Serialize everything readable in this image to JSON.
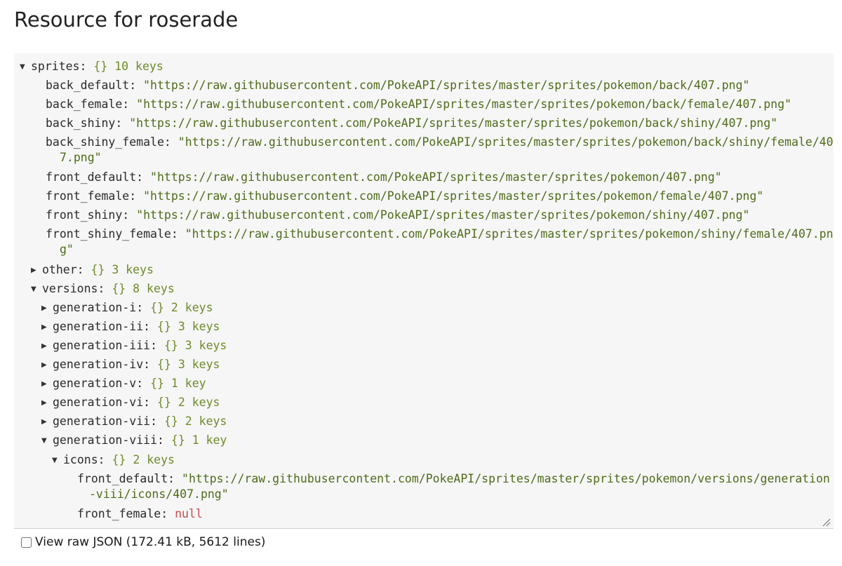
{
  "page": {
    "title": "Resource for roserade"
  },
  "tree": {
    "sprites": {
      "key": "sprites",
      "brace": "{}",
      "count": "10 keys",
      "entries": {
        "back_default": {
          "key": "back_default",
          "value": "\"https://raw.githubusercontent.com/PokeAPI/sprites/master/sprites/pokemon/back/407.png\""
        },
        "back_female": {
          "key": "back_female",
          "value": "\"https://raw.githubusercontent.com/PokeAPI/sprites/master/sprites/pokemon/back/female/407.png\""
        },
        "back_shiny": {
          "key": "back_shiny",
          "value": "\"https://raw.githubusercontent.com/PokeAPI/sprites/master/sprites/pokemon/back/shiny/407.png\""
        },
        "back_shiny_female": {
          "key": "back_shiny_female",
          "value": "\"https://raw.githubusercontent.com/PokeAPI/sprites/master/sprites/pokemon/back/shiny/female/407.png\""
        },
        "front_default": {
          "key": "front_default",
          "value": "\"https://raw.githubusercontent.com/PokeAPI/sprites/master/sprites/pokemon/407.png\""
        },
        "front_female": {
          "key": "front_female",
          "value": "\"https://raw.githubusercontent.com/PokeAPI/sprites/master/sprites/pokemon/female/407.png\""
        },
        "front_shiny": {
          "key": "front_shiny",
          "value": "\"https://raw.githubusercontent.com/PokeAPI/sprites/master/sprites/pokemon/shiny/407.png\""
        },
        "front_shiny_female": {
          "key": "front_shiny_female",
          "value": "\"https://raw.githubusercontent.com/PokeAPI/sprites/master/sprites/pokemon/shiny/female/407.png\""
        }
      },
      "other": {
        "key": "other",
        "brace": "{}",
        "count": "3 keys"
      },
      "versions": {
        "key": "versions",
        "brace": "{}",
        "count": "8 keys",
        "generations": {
          "gen_i": {
            "key": "generation-i",
            "brace": "{}",
            "count": "2 keys"
          },
          "gen_ii": {
            "key": "generation-ii",
            "brace": "{}",
            "count": "3 keys"
          },
          "gen_iii": {
            "key": "generation-iii",
            "brace": "{}",
            "count": "3 keys"
          },
          "gen_iv": {
            "key": "generation-iv",
            "brace": "{}",
            "count": "3 keys"
          },
          "gen_v": {
            "key": "generation-v",
            "brace": "{}",
            "count": "1 key"
          },
          "gen_vi": {
            "key": "generation-vi",
            "brace": "{}",
            "count": "2 keys"
          },
          "gen_vii": {
            "key": "generation-vii",
            "brace": "{}",
            "count": "2 keys"
          },
          "gen_viii": {
            "key": "generation-viii",
            "brace": "{}",
            "count": "1 key",
            "icons": {
              "key": "icons",
              "brace": "{}",
              "count": "2 keys",
              "front_default": {
                "key": "front_default",
                "value": "\"https://raw.githubusercontent.com/PokeAPI/sprites/master/sprites/pokemon/versions/generation-viii/icons/407.png\""
              },
              "front_female": {
                "key": "front_female",
                "value": "null"
              }
            }
          }
        }
      }
    }
  },
  "footer": {
    "raw_json_label": "View raw JSON (172.41 kB, 5612 lines)"
  },
  "icons": {
    "expanded": "expanded-triangle-icon",
    "collapsed": "collapsed-triangle-icon",
    "resize": "resize-grip-icon"
  },
  "colors": {
    "viewer_background": "#f6f6f6",
    "brace_count": "#6f8a2a",
    "string_value": "#4f6b1a",
    "null_value": "#c24e4e"
  }
}
